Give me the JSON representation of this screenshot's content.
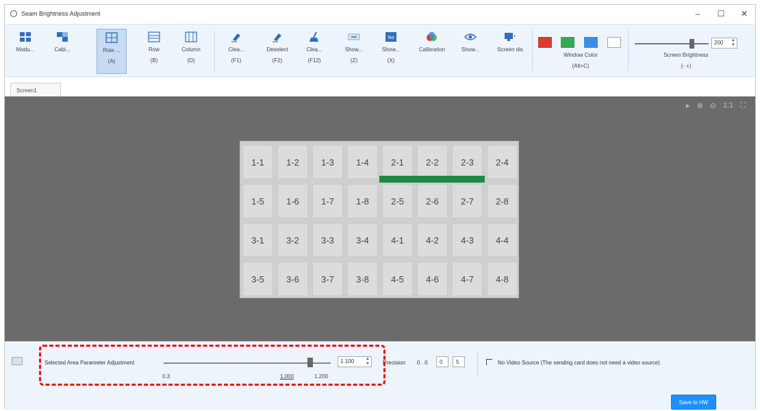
{
  "window": {
    "title": "Seam Brightness Adjustment",
    "controls": [
      "–",
      "☐",
      "✕"
    ]
  },
  "toolbar": {
    "tools": [
      {
        "label": "Modu...",
        "key": "",
        "icon": "module-icon"
      },
      {
        "label": "Cabi...",
        "key": "",
        "icon": "cabinet-icon"
      },
      {
        "label": "Row ...",
        "key": "(A)",
        "icon": "row-grid-icon",
        "active": true
      },
      {
        "label": "Row",
        "key": "(B)",
        "icon": "row-icon"
      },
      {
        "label": "Column",
        "key": "(D)",
        "icon": "column-icon"
      },
      {
        "label": "Clea...",
        "key": "(F1)",
        "icon": "eraser-icon"
      },
      {
        "label": "Deselect",
        "key": "(F2)",
        "icon": "deselect-icon"
      },
      {
        "label": "Clea...",
        "key": "(F12)",
        "icon": "broom-icon"
      },
      {
        "label": "Show...",
        "key": "(Z)",
        "icon": "show-seams-icon"
      },
      {
        "label": "Show...",
        "key": "(X)",
        "icon": "show-no-icon"
      },
      {
        "label": "Calibration",
        "key": "",
        "icon": "calibration-icon"
      },
      {
        "label": "Show...",
        "key": "",
        "icon": "eye-icon"
      },
      {
        "label": "Screen dis",
        "key": "",
        "icon": "screen-display-icon"
      }
    ],
    "window_color": {
      "label": "Window Color",
      "key": "(Alt+C)",
      "swatches": [
        "#d93a2b",
        "#34a853",
        "#3a8ee6",
        "#ffffff"
      ]
    },
    "screen_brightness": {
      "label": "Screen Brightness",
      "key": "(- +)",
      "value": "200",
      "level": 0.78
    }
  },
  "tabs": [
    {
      "label": "Screen1"
    }
  ],
  "zoom_tools": [
    "▸",
    "⊕",
    "⊖",
    "1:1",
    "⛶"
  ],
  "grid": {
    "rows": [
      [
        "1-1",
        "1-2",
        "1-3",
        "1-4",
        "2-1",
        "2-2",
        "2-3",
        "2-4"
      ],
      [
        "1-5",
        "1-6",
        "1-7",
        "1-8",
        "2-5",
        "2-6",
        "2-7",
        "2-8"
      ],
      [
        "3-1",
        "3-2",
        "3-3",
        "3-4",
        "4-1",
        "4-2",
        "4-3",
        "4-4"
      ],
      [
        "3-5",
        "3-6",
        "3-7",
        "3-8",
        "4-5",
        "4-6",
        "4-7",
        "4-8"
      ]
    ],
    "seam_color": "#1f8a44"
  },
  "param": {
    "label": "Selected Area Parameter Adjustment",
    "value": "1.100",
    "min_label": "0.3",
    "mid_label": "1.000",
    "max_label": "1.200"
  },
  "precision": {
    "label": "Precision",
    "prefix": "0 . 0",
    "digit1": "0",
    "digit2": "5"
  },
  "no_video": {
    "label": "No Video Source (The sending card does not need a video source)"
  },
  "save": {
    "label": "Save to HW"
  }
}
